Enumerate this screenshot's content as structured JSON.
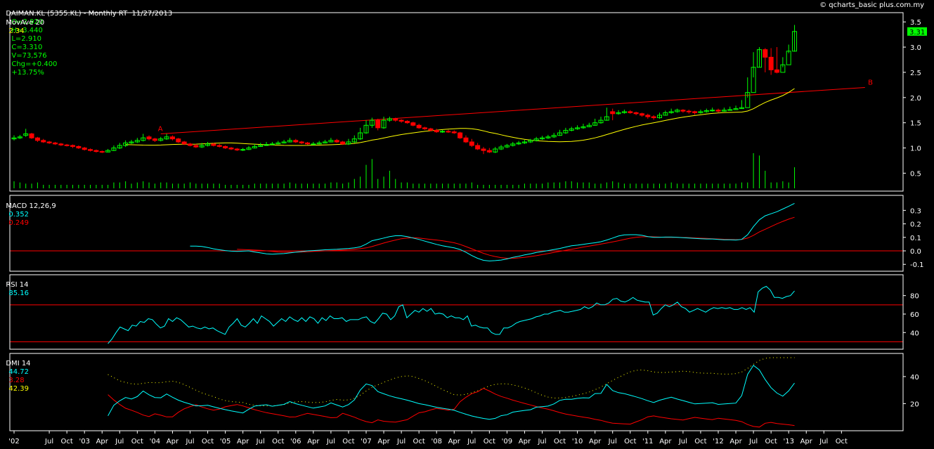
{
  "header": {
    "symbol": "DAIMAN.KL (5355.KL) - Monthly RT  11/27/2013",
    "open": "O=2.920",
    "high": "H=3.440",
    "low": "L=2.910",
    "close": "C=3.310",
    "volume": "V=73,576",
    "change": "Chg=+0.400",
    "change_pct": "+13.75%",
    "source": "© qcharts_basic plus.com.my"
  },
  "colors": {
    "background": "#000000",
    "up": "#00ff00",
    "down": "#ff0000",
    "ma": "#ffff00",
    "macd": "#00ffff",
    "signal": "#ff0000",
    "trendline": "#ff0000",
    "axis": "#ffffff",
    "hline": "#ff0000",
    "dmi_plus": "#00ffff",
    "dmi_minus": "#ff0000",
    "adx": "#ffff00",
    "last_price_bg": "#00ff00"
  },
  "chart_data": [
    {
      "type": "candlestick",
      "panel": "price",
      "overlay_label": "MovAve 20",
      "overlay_value": "2.34",
      "last_price_label": "3.31",
      "ylim": [
        0.2,
        3.6
      ],
      "y_ticks": [
        "0.5",
        "1.0",
        "1.5",
        "2.0",
        "2.5",
        "3.0",
        "3.5"
      ],
      "grid": false,
      "annotations": [
        {
          "text": "A",
          "x": "2004-02",
          "y": 1.28
        },
        {
          "text": "B",
          "x": "2014-03",
          "y": 2.2
        }
      ],
      "trendline": {
        "from": {
          "x": "2004-02",
          "y": 1.28
        },
        "to": {
          "x": "2014-02",
          "y": 2.2
        }
      },
      "x_start": "2002-01",
      "x_tick_labels": [
        "'02",
        "Jul",
        "Oct",
        "'03",
        "Apr",
        "Jul",
        "Oct",
        "'04",
        "Apr",
        "Jul",
        "Oct",
        "'05",
        "Apr",
        "Jul",
        "Oct",
        "'06",
        "Apr",
        "Jul",
        "Oct",
        "'07",
        "Apr",
        "Jul",
        "Oct",
        "'08",
        "Apr",
        "Jul",
        "Oct",
        "'09",
        "Apr",
        "Jul",
        "Oct",
        "'10",
        "Apr",
        "Jul",
        "Oct",
        "'11",
        "Apr",
        "Jul",
        "Oct",
        "'12",
        "Apr",
        "Jul",
        "Oct",
        "'13",
        "Apr",
        "Jul",
        "Oct"
      ],
      "close": [
        1.2,
        1.22,
        1.28,
        1.2,
        1.15,
        1.12,
        1.1,
        1.08,
        1.06,
        1.05,
        1.03,
        1.0,
        0.97,
        0.95,
        0.93,
        0.92,
        0.95,
        1.0,
        1.05,
        1.1,
        1.12,
        1.15,
        1.2,
        1.18,
        1.15,
        1.18,
        1.22,
        1.18,
        1.12,
        1.08,
        1.05,
        1.02,
        1.05,
        1.08,
        1.05,
        1.03,
        1.0,
        0.98,
        0.96,
        0.97,
        1.0,
        1.03,
        1.05,
        1.07,
        1.08,
        1.1,
        1.12,
        1.15,
        1.12,
        1.1,
        1.08,
        1.08,
        1.1,
        1.12,
        1.15,
        1.12,
        1.08,
        1.12,
        1.18,
        1.3,
        1.45,
        1.55,
        1.4,
        1.55,
        1.58,
        1.55,
        1.53,
        1.5,
        1.45,
        1.4,
        1.38,
        1.35,
        1.32,
        1.33,
        1.32,
        1.3,
        1.2,
        1.12,
        1.05,
        0.98,
        0.95,
        0.92,
        0.98,
        1.02,
        1.05,
        1.08,
        1.1,
        1.12,
        1.15,
        1.18,
        1.2,
        1.22,
        1.25,
        1.3,
        1.35,
        1.38,
        1.4,
        1.42,
        1.45,
        1.5,
        1.55,
        1.62,
        1.68,
        1.7,
        1.72,
        1.7,
        1.68,
        1.65,
        1.62,
        1.6,
        1.65,
        1.7,
        1.72,
        1.75,
        1.73,
        1.72,
        1.7,
        1.72,
        1.74,
        1.75,
        1.73,
        1.75,
        1.76,
        1.78,
        1.8,
        2.1,
        2.6,
        2.95,
        2.8,
        2.55,
        2.5,
        2.65,
        2.92,
        3.31
      ],
      "open": [
        1.18,
        1.2,
        1.25,
        1.28,
        1.2,
        1.15,
        1.12,
        1.1,
        1.08,
        1.06,
        1.05,
        1.03,
        1.0,
        0.97,
        0.95,
        0.93,
        0.92,
        0.95,
        1.0,
        1.05,
        1.1,
        1.12,
        1.15,
        1.22,
        1.18,
        1.15,
        1.18,
        1.22,
        1.18,
        1.12,
        1.08,
        1.05,
        1.02,
        1.05,
        1.08,
        1.05,
        1.03,
        1.0,
        0.98,
        0.96,
        0.97,
        1.0,
        1.03,
        1.05,
        1.07,
        1.08,
        1.1,
        1.12,
        1.15,
        1.12,
        1.1,
        1.08,
        1.08,
        1.1,
        1.12,
        1.15,
        1.12,
        1.08,
        1.12,
        1.18,
        1.3,
        1.45,
        1.55,
        1.4,
        1.55,
        1.58,
        1.55,
        1.53,
        1.5,
        1.45,
        1.4,
        1.38,
        1.35,
        1.32,
        1.33,
        1.32,
        1.3,
        1.2,
        1.12,
        1.05,
        0.98,
        0.95,
        0.92,
        0.98,
        1.02,
        1.05,
        1.08,
        1.1,
        1.12,
        1.15,
        1.18,
        1.2,
        1.22,
        1.25,
        1.3,
        1.35,
        1.38,
        1.4,
        1.42,
        1.45,
        1.5,
        1.55,
        1.72,
        1.68,
        1.7,
        1.72,
        1.7,
        1.68,
        1.65,
        1.62,
        1.6,
        1.65,
        1.7,
        1.72,
        1.75,
        1.73,
        1.72,
        1.7,
        1.72,
        1.74,
        1.75,
        1.73,
        1.75,
        1.76,
        1.78,
        1.8,
        2.1,
        2.6,
        2.95,
        2.8,
        2.55,
        2.5,
        2.65,
        2.92
      ],
      "high": [
        1.25,
        1.26,
        1.38,
        1.3,
        1.22,
        1.18,
        1.14,
        1.12,
        1.1,
        1.08,
        1.07,
        1.05,
        1.02,
        0.99,
        0.97,
        0.95,
        0.98,
        1.05,
        1.1,
        1.15,
        1.16,
        1.2,
        1.28,
        1.25,
        1.2,
        1.22,
        1.28,
        1.25,
        1.2,
        1.14,
        1.1,
        1.08,
        1.1,
        1.12,
        1.1,
        1.08,
        1.05,
        1.02,
        1.0,
        1.0,
        1.04,
        1.08,
        1.1,
        1.12,
        1.12,
        1.14,
        1.16,
        1.2,
        1.18,
        1.14,
        1.12,
        1.12,
        1.14,
        1.16,
        1.2,
        1.18,
        1.14,
        1.18,
        1.25,
        1.4,
        1.55,
        1.6,
        1.58,
        1.62,
        1.62,
        1.6,
        1.57,
        1.55,
        1.52,
        1.48,
        1.42,
        1.4,
        1.38,
        1.36,
        1.36,
        1.35,
        1.32,
        1.25,
        1.18,
        1.1,
        1.02,
        1.0,
        1.02,
        1.06,
        1.08,
        1.12,
        1.14,
        1.16,
        1.18,
        1.22,
        1.24,
        1.26,
        1.3,
        1.36,
        1.4,
        1.42,
        1.45,
        1.48,
        1.5,
        1.58,
        1.62,
        1.8,
        1.78,
        1.75,
        1.76,
        1.75,
        1.72,
        1.7,
        1.68,
        1.65,
        1.7,
        1.74,
        1.78,
        1.78,
        1.77,
        1.76,
        1.74,
        1.76,
        1.78,
        1.8,
        1.78,
        1.8,
        1.82,
        1.84,
        1.95,
        2.4,
        2.9,
        3.0,
        2.98,
        2.98,
        3.0,
        2.8,
        3.05,
        3.44
      ],
      "low": [
        1.15,
        1.18,
        1.22,
        1.18,
        1.12,
        1.1,
        1.08,
        1.06,
        1.04,
        1.03,
        1.0,
        0.98,
        0.95,
        0.93,
        0.91,
        0.9,
        0.91,
        0.94,
        0.98,
        1.02,
        1.08,
        1.1,
        1.13,
        1.15,
        1.12,
        1.13,
        1.16,
        1.15,
        1.1,
        1.06,
        1.03,
        1.0,
        1.0,
        1.03,
        1.03,
        1.01,
        0.98,
        0.96,
        0.94,
        0.94,
        0.96,
        0.99,
        1.02,
        1.04,
        1.06,
        1.07,
        1.09,
        1.11,
        1.1,
        1.08,
        1.06,
        1.06,
        1.07,
        1.09,
        1.11,
        1.1,
        1.06,
        1.06,
        1.1,
        1.16,
        1.28,
        1.4,
        1.35,
        1.38,
        1.52,
        1.52,
        1.5,
        1.48,
        1.43,
        1.38,
        1.36,
        1.33,
        1.3,
        1.3,
        1.3,
        1.28,
        1.18,
        1.1,
        1.02,
        0.96,
        0.88,
        0.9,
        0.9,
        0.96,
        1.0,
        1.03,
        1.06,
        1.08,
        1.1,
        1.13,
        1.16,
        1.18,
        1.2,
        1.24,
        1.28,
        1.33,
        1.36,
        1.38,
        1.41,
        1.44,
        1.48,
        1.54,
        1.55,
        1.66,
        1.68,
        1.68,
        1.65,
        1.62,
        1.58,
        1.56,
        1.58,
        1.64,
        1.68,
        1.7,
        1.7,
        1.68,
        1.66,
        1.68,
        1.7,
        1.72,
        1.7,
        1.72,
        1.74,
        1.76,
        1.78,
        2.0,
        2.4,
        2.6,
        2.5,
        2.45,
        2.48,
        2.6,
        2.88,
        2.91
      ],
      "volume": [
        0.06,
        0.05,
        0.04,
        0.04,
        0.05,
        0.03,
        0.03,
        0.03,
        0.03,
        0.03,
        0.03,
        0.03,
        0.03,
        0.03,
        0.03,
        0.03,
        0.03,
        0.05,
        0.05,
        0.06,
        0.04,
        0.05,
        0.06,
        0.05,
        0.04,
        0.05,
        0.05,
        0.04,
        0.04,
        0.04,
        0.05,
        0.04,
        0.04,
        0.04,
        0.04,
        0.04,
        0.03,
        0.03,
        0.03,
        0.03,
        0.03,
        0.04,
        0.04,
        0.04,
        0.04,
        0.04,
        0.04,
        0.05,
        0.04,
        0.04,
        0.04,
        0.04,
        0.04,
        0.04,
        0.05,
        0.05,
        0.04,
        0.05,
        0.08,
        0.1,
        0.2,
        0.25,
        0.08,
        0.1,
        0.15,
        0.08,
        0.05,
        0.05,
        0.04,
        0.04,
        0.04,
        0.04,
        0.04,
        0.04,
        0.04,
        0.04,
        0.04,
        0.04,
        0.05,
        0.03,
        0.03,
        0.03,
        0.03,
        0.03,
        0.03,
        0.03,
        0.03,
        0.04,
        0.04,
        0.04,
        0.04,
        0.05,
        0.05,
        0.05,
        0.06,
        0.06,
        0.05,
        0.05,
        0.05,
        0.04,
        0.04,
        0.05,
        0.06,
        0.05,
        0.04,
        0.04,
        0.04,
        0.04,
        0.04,
        0.04,
        0.04,
        0.04,
        0.05,
        0.04,
        0.04,
        0.04,
        0.04,
        0.04,
        0.04,
        0.04,
        0.04,
        0.04,
        0.04,
        0.04,
        0.05,
        0.05,
        0.3,
        0.28,
        0.15,
        0.05,
        0.05,
        0.06,
        0.05,
        0.18
      ]
    },
    {
      "type": "line",
      "panel": "macd",
      "label": "MACD 12,26,9",
      "macd_value": "0.352",
      "signal_value": "0.249",
      "ylim": [
        -0.13,
        0.38
      ],
      "y_ticks": [
        "-0.1",
        "0.0",
        "0.1",
        "0.2",
        "0.3"
      ],
      "zero_line": 0,
      "macd": [
        null,
        null,
        null,
        null,
        null,
        null,
        null,
        null,
        null,
        null,
        null,
        null,
        null,
        null,
        null,
        null,
        null,
        null,
        null,
        null,
        null,
        null,
        null,
        null,
        null,
        null,
        null,
        null,
        null,
        null,
        0.035,
        0.035,
        0.033,
        0.025,
        0.015,
        0.008,
        0.002,
        -0.002,
        -0.004,
        -0.002,
        0.0,
        -0.008,
        -0.015,
        -0.022,
        -0.025,
        -0.022,
        -0.02,
        -0.015,
        -0.01,
        -0.005,
        0.0,
        0.002,
        0.005,
        0.008,
        0.01,
        0.012,
        0.015,
        0.018,
        0.022,
        0.03,
        0.05,
        0.075,
        0.085,
        0.095,
        0.105,
        0.112,
        0.112,
        0.105,
        0.095,
        0.085,
        0.072,
        0.06,
        0.048,
        0.038,
        0.03,
        0.022,
        0.01,
        -0.01,
        -0.035,
        -0.055,
        -0.07,
        -0.075,
        -0.072,
        -0.068,
        -0.06,
        -0.048,
        -0.04,
        -0.03,
        -0.022,
        -0.012,
        -0.005,
        0.002,
        0.01,
        0.018,
        0.028,
        0.038,
        0.042,
        0.048,
        0.055,
        0.06,
        0.068,
        0.08,
        0.095,
        0.11,
        0.118,
        0.12,
        0.12,
        0.115,
        0.105,
        0.1,
        0.1,
        0.102,
        0.102,
        0.1,
        0.098,
        0.095,
        0.092,
        0.09,
        0.088,
        0.088,
        0.085,
        0.082,
        0.082,
        0.08,
        0.085,
        0.12,
        0.18,
        0.23,
        0.26,
        0.275,
        0.29,
        0.31,
        0.33,
        0.352
      ],
      "signal": [
        null,
        null,
        null,
        null,
        null,
        null,
        null,
        null,
        null,
        null,
        null,
        null,
        null,
        null,
        null,
        null,
        null,
        null,
        null,
        null,
        null,
        null,
        null,
        null,
        null,
        null,
        null,
        null,
        null,
        null,
        null,
        null,
        null,
        null,
        null,
        null,
        null,
        null,
        0.012,
        0.01,
        0.008,
        0.006,
        0.004,
        0.0,
        -0.004,
        -0.008,
        -0.01,
        -0.01,
        -0.01,
        -0.008,
        -0.006,
        -0.004,
        -0.002,
        0.0,
        0.002,
        0.004,
        0.006,
        0.008,
        0.012,
        0.016,
        0.022,
        0.032,
        0.045,
        0.058,
        0.07,
        0.08,
        0.09,
        0.095,
        0.098,
        0.095,
        0.09,
        0.085,
        0.08,
        0.075,
        0.068,
        0.06,
        0.048,
        0.032,
        0.015,
        -0.002,
        -0.018,
        -0.032,
        -0.042,
        -0.05,
        -0.055,
        -0.055,
        -0.052,
        -0.048,
        -0.042,
        -0.036,
        -0.028,
        -0.02,
        -0.012,
        -0.004,
        0.004,
        0.012,
        0.02,
        0.028,
        0.035,
        0.042,
        0.05,
        0.058,
        0.066,
        0.075,
        0.085,
        0.094,
        0.1,
        0.104,
        0.105,
        0.104,
        0.102,
        0.1,
        0.1,
        0.1,
        0.099,
        0.098,
        0.096,
        0.094,
        0.092,
        0.09,
        0.088,
        0.086,
        0.085,
        0.083,
        0.085,
        0.095,
        0.115,
        0.14,
        0.16,
        0.18,
        0.2,
        0.218,
        0.235,
        0.249
      ]
    },
    {
      "type": "line",
      "panel": "rsi",
      "label": "RSI 14",
      "value": "85.16",
      "ylim": [
        25,
        98
      ],
      "y_ticks": [
        "40",
        "60",
        "80"
      ],
      "hlines": [
        30,
        70
      ],
      "rsi": [
        null,
        null,
        null,
        null,
        null,
        null,
        null,
        null,
        null,
        null,
        null,
        null,
        null,
        null,
        null,
        null,
        null,
        null,
        null,
        null,
        null,
        null,
        null,
        null,
        null,
        null,
        null,
        null,
        null,
        null,
        28,
        33,
        40,
        46,
        44,
        42,
        48,
        47,
        52,
        51,
        55,
        54,
        49,
        45,
        47,
        55,
        52,
        56,
        54,
        50,
        46,
        47,
        45,
        44,
        46,
        44,
        45,
        42,
        40,
        38,
        46,
        50,
        55,
        48,
        46,
        50,
        55,
        50,
        58,
        55,
        52,
        47,
        51,
        55,
        52,
        57,
        54,
        52,
        56,
        52,
        57,
        55,
        50,
        56,
        53,
        58,
        55,
        55,
        56,
        52,
        54,
        54,
        54,
        56,
        57,
        52,
        50,
        55,
        61,
        60,
        54,
        58,
        68,
        70,
        56,
        60,
        64,
        62,
        66,
        63,
        66,
        60,
        61,
        60,
        56,
        58,
        56,
        56,
        54,
        58,
        47,
        48,
        46,
        45,
        45,
        40,
        38,
        38,
        45,
        45,
        47,
        50,
        52,
        53,
        54,
        55,
        57,
        58,
        60,
        60,
        62,
        63,
        64,
        62,
        62,
        63,
        64,
        65,
        68,
        66,
        68,
        72,
        70,
        70,
        72,
        76,
        77,
        74,
        73,
        75,
        78,
        75,
        74,
        73,
        73,
        59,
        61,
        66,
        70,
        68,
        70,
        73,
        68,
        66,
        62,
        64,
        66,
        64,
        62,
        65,
        67,
        66,
        67,
        66,
        67,
        65,
        65,
        67,
        65,
        67,
        62,
        84,
        88,
        90,
        86,
        78,
        78,
        77,
        79,
        80,
        85
      ],
      "note": "approximate"
    },
    {
      "type": "line",
      "panel": "dmi",
      "label": "DMI 14",
      "plus_di_value": "44.72",
      "minus_di_value": "3.28",
      "adx_value": "42.39",
      "ylim": [
        2,
        54
      ],
      "y_ticks": [
        "20",
        "40"
      ],
      "grid": false
    }
  ]
}
